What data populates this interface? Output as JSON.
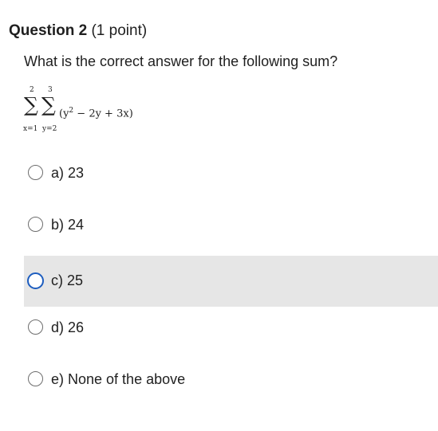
{
  "question": {
    "title": "Question 2",
    "points": "(1 point)",
    "prompt": "What is the correct answer for the following sum?"
  },
  "formula": {
    "outer_upper": "2",
    "outer_lower": "x=1",
    "inner_upper": "3",
    "inner_lower": "y=2",
    "sigma": "∑",
    "expression_prefix": "(y",
    "exponent": "2",
    "expression_suffix": " − 2y + 3x)"
  },
  "options": [
    {
      "label": "a) 23"
    },
    {
      "label": "b) 24"
    },
    {
      "label": "c) 25"
    },
    {
      "label": "d) 26"
    },
    {
      "label": "e) None of the above"
    }
  ],
  "colors": {
    "highlight": "#e6e6e6",
    "focus_ring": "#1d5dbf",
    "radio_border": "#6d6d6d"
  }
}
